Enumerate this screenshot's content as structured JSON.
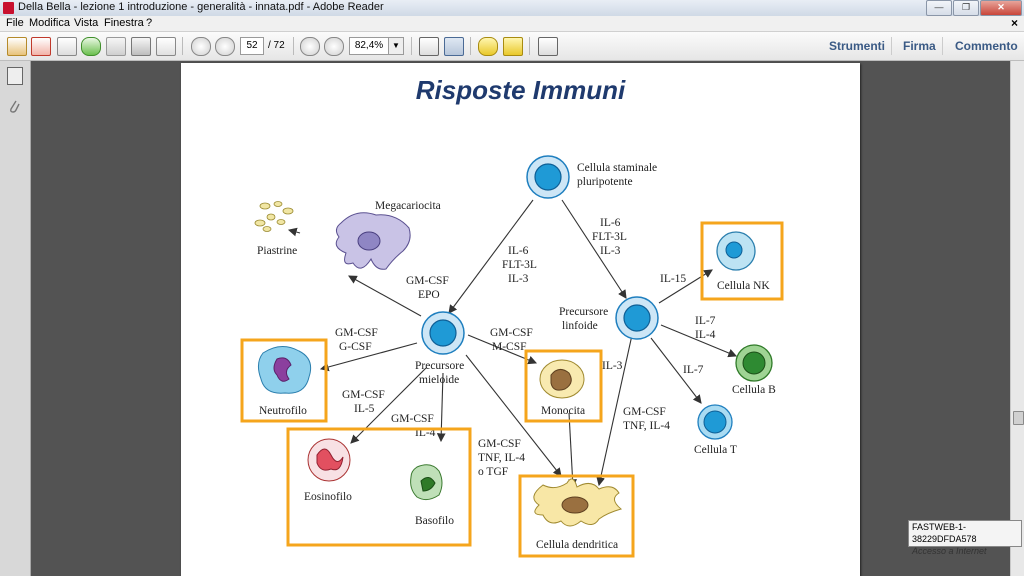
{
  "window": {
    "title": "Della Bella - lezione 1 introduzione - generalità - innata.pdf - Adobe Reader",
    "minimize": "—",
    "restore": "❐",
    "close": "✕"
  },
  "menu": [
    "File",
    "Modifica",
    "Vista",
    "Finestra",
    "?"
  ],
  "doc_close": "×",
  "toolbar": {
    "page_current": "52",
    "page_total": "/ 72",
    "zoom": "82,4%",
    "zoom_dropdown": "▼",
    "strumenti": "Strumenti",
    "firma": "Firma",
    "commento": "Commento"
  },
  "slide": {
    "title": "Risposte Immuni",
    "cells": {
      "staminale_1": "Cellula staminale",
      "staminale_2": "pluripotente",
      "megacariocita": "Megacariocita",
      "piastrine": "Piastrine",
      "precursore_mieloide_1": "Precursore",
      "precursore_mieloide_2": "mieloide",
      "precursore_linfoide_1": "Precursore",
      "precursore_linfoide_2": "linfoide",
      "neutrofilo": "Neutrofilo",
      "eosinofilo": "Eosinofilo",
      "basofilo": "Basofilo",
      "monocita": "Monocita",
      "dendritica": "Cellula dendritica",
      "nk": "Cellula NK",
      "cellula_b": "Cellula B",
      "cellula_t": "Cellula T"
    },
    "factors": {
      "il6_a": "IL-6",
      "flt3l_a": "FLT-3L",
      "il3_a": "IL-3",
      "il6_b": "IL-6",
      "flt3l_b": "FLT-3L",
      "il3_b": "IL-3",
      "gmcsf_epo_1": "GM-CSF",
      "gmcsf_epo_2": "EPO",
      "gmcsf_gcsf_1": "GM-CSF",
      "gmcsf_gcsf_2": "G-CSF",
      "gmcsf_mcsf_1": "GM-CSF",
      "gmcsf_mcsf_2": "M-CSF",
      "gmcsf_il5_1": "GM-CSF",
      "gmcsf_il5_2": "IL-5",
      "gmcsf_il4_1": "GM-CSF",
      "gmcsf_il4_2": "IL-4",
      "gmcsf_tnf_1": "GM-CSF",
      "gmcsf_tnf_2": "TNF, IL-4",
      "gmcsf_tnf_3": "o TGF",
      "il3_c": "IL-3",
      "gmcsf_tnf_b_1": "GM-CSF",
      "gmcsf_tnf_b_2": "TNF, IL-4",
      "il15": "IL-15",
      "il7_il4_1": "IL-7",
      "il7_il4_2": "IL-4",
      "il7": "IL-7"
    },
    "highlight_color": "#f5a51c",
    "cell_blue": "#1f9ad6"
  },
  "tooltip": {
    "line1": "FASTWEB-1-38229DFDA578",
    "line2": "Accesso a Internet"
  }
}
